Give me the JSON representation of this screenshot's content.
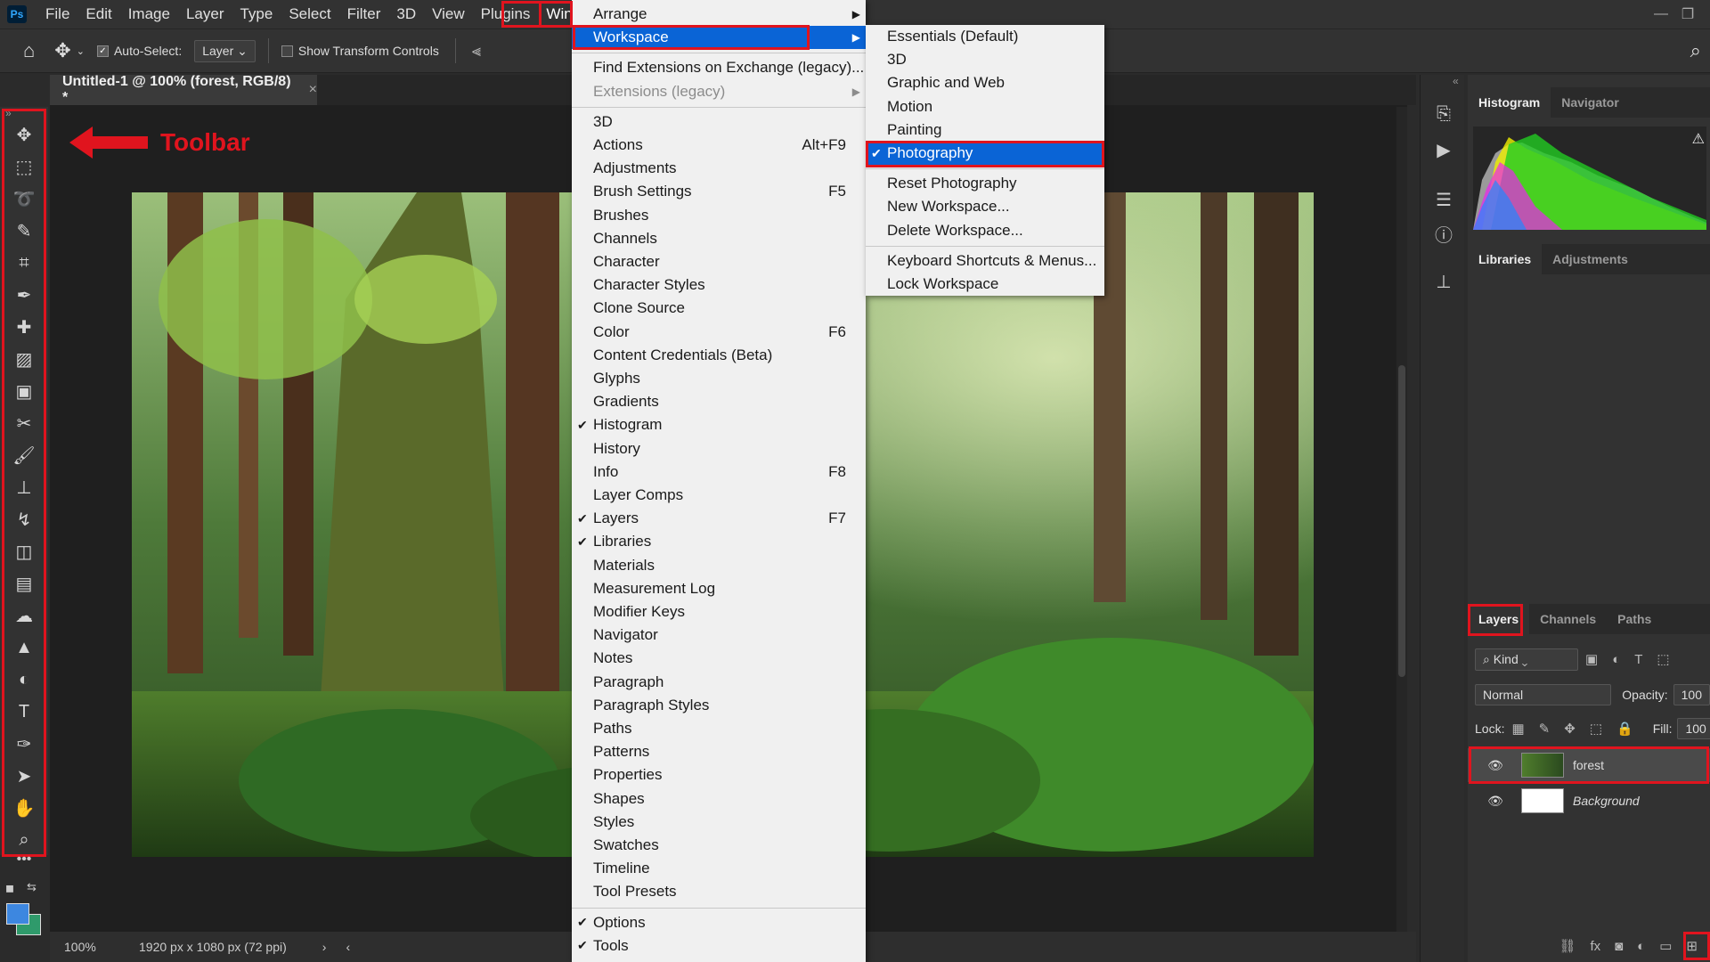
{
  "menubar": {
    "logo": "Ps",
    "items": [
      "File",
      "Edit",
      "Image",
      "Layer",
      "Type",
      "Select",
      "Filter",
      "3D",
      "View",
      "Plugins",
      "Window"
    ],
    "highlighted": "Window"
  },
  "options": {
    "auto_select_label": "Auto-Select:",
    "auto_select_checked": true,
    "layer_select": "Layer",
    "show_transform_label": "Show Transform Controls",
    "show_transform_checked": false
  },
  "document": {
    "tab_title": "Untitled-1 @ 100% (forest, RGB/8) *",
    "close": "×"
  },
  "annotation": {
    "toolbar_label": "Toolbar",
    "color": "#e0141e"
  },
  "status": {
    "zoom": "100%",
    "doc_info": "1920 px x 1080 px (72 ppi)"
  },
  "window_menu": {
    "items": [
      {
        "label": "Arrange",
        "submenu": true
      },
      {
        "label": "Workspace",
        "submenu": true,
        "active": true
      },
      {
        "sep": true
      },
      {
        "label": "Find Extensions on Exchange (legacy)..."
      },
      {
        "label": "Extensions (legacy)",
        "submenu": true,
        "disabled": true
      },
      {
        "sep": true
      },
      {
        "label": "3D"
      },
      {
        "label": "Actions",
        "shortcut": "Alt+F9"
      },
      {
        "label": "Adjustments"
      },
      {
        "label": "Brush Settings",
        "shortcut": "F5"
      },
      {
        "label": "Brushes"
      },
      {
        "label": "Channels"
      },
      {
        "label": "Character"
      },
      {
        "label": "Character Styles"
      },
      {
        "label": "Clone Source"
      },
      {
        "label": "Color",
        "shortcut": "F6"
      },
      {
        "label": "Content Credentials (Beta)"
      },
      {
        "label": "Glyphs"
      },
      {
        "label": "Gradients"
      },
      {
        "label": "Histogram",
        "checked": true
      },
      {
        "label": "History"
      },
      {
        "label": "Info",
        "shortcut": "F8"
      },
      {
        "label": "Layer Comps"
      },
      {
        "label": "Layers",
        "shortcut": "F7",
        "checked": true
      },
      {
        "label": "Libraries",
        "checked": true
      },
      {
        "label": "Materials"
      },
      {
        "label": "Measurement Log"
      },
      {
        "label": "Modifier Keys"
      },
      {
        "label": "Navigator"
      },
      {
        "label": "Notes"
      },
      {
        "label": "Paragraph"
      },
      {
        "label": "Paragraph Styles"
      },
      {
        "label": "Paths"
      },
      {
        "label": "Patterns"
      },
      {
        "label": "Properties"
      },
      {
        "label": "Shapes"
      },
      {
        "label": "Styles"
      },
      {
        "label": "Swatches"
      },
      {
        "label": "Timeline"
      },
      {
        "label": "Tool Presets"
      },
      {
        "sep": true
      },
      {
        "label": "Options",
        "checked": true
      },
      {
        "label": "Tools",
        "checked": true
      }
    ]
  },
  "workspace_menu": {
    "items": [
      {
        "label": "Essentials (Default)"
      },
      {
        "label": "3D"
      },
      {
        "label": "Graphic and Web"
      },
      {
        "label": "Motion"
      },
      {
        "label": "Painting"
      },
      {
        "label": "Photography",
        "checked": true,
        "active": true
      },
      {
        "sep": true
      },
      {
        "label": "Reset Photography"
      },
      {
        "label": "New Workspace..."
      },
      {
        "label": "Delete Workspace..."
      },
      {
        "sep": true
      },
      {
        "label": "Keyboard Shortcuts & Menus..."
      },
      {
        "label": "Lock Workspace"
      }
    ]
  },
  "panels": {
    "top_tabs": [
      "Histogram",
      "Navigator"
    ],
    "mid_tabs": [
      "Libraries",
      "Adjustments"
    ],
    "layer_tabs": [
      "Layers",
      "Channels",
      "Paths"
    ],
    "kind_label": "Kind",
    "blend_mode": "Normal",
    "opacity_label": "Opacity:",
    "opacity_value": "100",
    "lock_label": "Lock:",
    "fill_label": "Fill:",
    "fill_value": "100",
    "layers": [
      {
        "name": "forest"
      },
      {
        "name": "Background"
      }
    ]
  }
}
